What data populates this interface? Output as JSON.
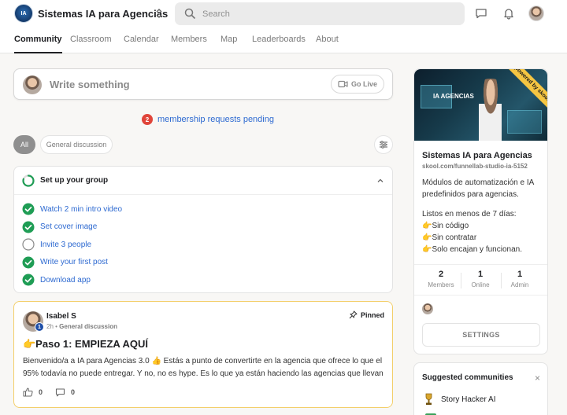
{
  "header": {
    "group_name": "Sistemas IA para Agencias",
    "logo_text": "IA",
    "search_placeholder": "Search"
  },
  "tabs": [
    "Community",
    "Classroom",
    "Calendar",
    "Members",
    "Map",
    "Leaderboards",
    "About"
  ],
  "active_tab": "Community",
  "composer": {
    "placeholder": "Write something",
    "go_live_label": "Go Live"
  },
  "pending": {
    "count": "2",
    "text": "membership requests pending"
  },
  "filters": {
    "all": "All",
    "general": "General discussion"
  },
  "setup": {
    "title": "Set up your group",
    "progress": 0.8,
    "tasks": [
      {
        "label": "Watch 2 min intro video",
        "done": true
      },
      {
        "label": "Set cover image",
        "done": true
      },
      {
        "label": "Invite 3 people",
        "done": false
      },
      {
        "label": "Write your first post",
        "done": true
      },
      {
        "label": "Download app",
        "done": true
      }
    ]
  },
  "post": {
    "author": "Isabel S",
    "level": "1",
    "time": "2h",
    "category": "General discussion",
    "pinned_label": "Pinned",
    "title": "👉Paso 1: EMPIEZA AQUÍ",
    "body": "Bienvenido/a a IA para Agencias 3.0 👍 Estás a punto de convertirte en la agencia que ofrece lo que el 95% todavía no puede entregar. Y no, no es hype. Es lo que ya están haciendo las agencias que llevan",
    "likes": "0",
    "comments": "0"
  },
  "about": {
    "cover_text": "IA AGENCIAS",
    "ribbon_text": "powered by skool",
    "title": "Sistemas IA para Agencias",
    "url": "skool.com/funnellab-studio-ia-5152",
    "description": "Módulos de automatización e IA predefinidos para agencias.",
    "list_intro": "Listos en menos de 7 días:",
    "list": [
      "👉Sin código",
      "👉Sin contratar",
      "👉Solo encajan y funcionan."
    ],
    "stats": [
      {
        "num": "2",
        "label": "Members"
      },
      {
        "num": "1",
        "label": "Online"
      },
      {
        "num": "1",
        "label": "Admin"
      }
    ],
    "settings_label": "SETTINGS"
  },
  "suggested": {
    "title": "Suggested communities",
    "close": "×",
    "items": [
      "Story Hacker AI"
    ]
  }
}
